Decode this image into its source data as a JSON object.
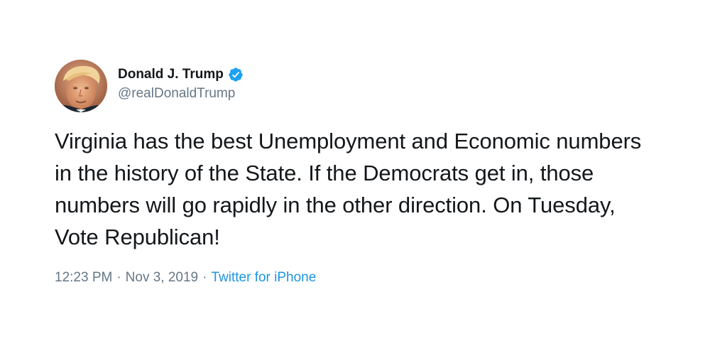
{
  "tweet": {
    "author": {
      "display_name": "Donald J. Trump",
      "handle": "@realDonaldTrump",
      "verified_icon": "verified-badge-icon",
      "avatar_icon": "profile-photo"
    },
    "text": "Virginia has the best Unemployment and Economic numbers in the history of the State. If the Democrats get in, those numbers will go rapidly in the other direction. On Tuesday, Vote Republican!",
    "time": "12:23 PM",
    "separator": "·",
    "date": "Nov 3, 2019",
    "source": "Twitter for iPhone"
  },
  "colors": {
    "text": "#14171a",
    "secondary": "#657786",
    "link": "#1b95e0",
    "verified": "#1da1f2",
    "background": "#ffffff"
  }
}
